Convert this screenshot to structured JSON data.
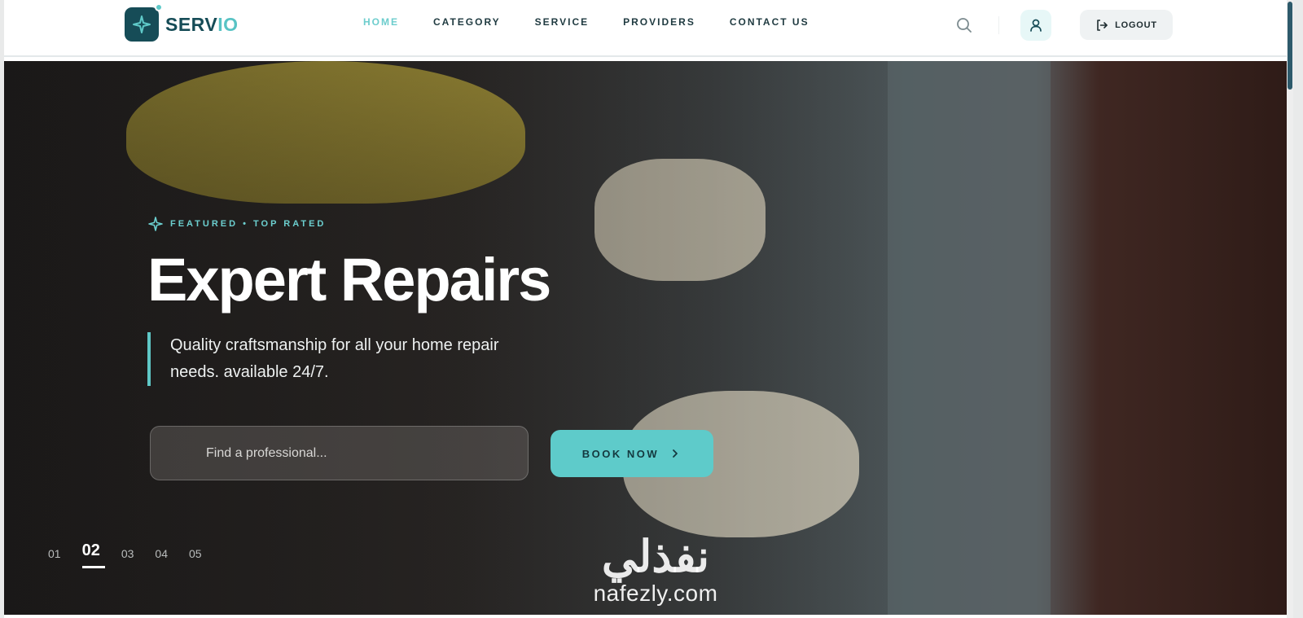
{
  "brand": {
    "name_part1": "SERV",
    "name_part2": "IO",
    "accent": "#5ecbca",
    "dark": "#164c57"
  },
  "nav": {
    "items": [
      {
        "label": "HOME",
        "active": true
      },
      {
        "label": "CATEGORY",
        "active": false
      },
      {
        "label": "SERVICE",
        "active": false
      },
      {
        "label": "PROVIDERS",
        "active": false
      },
      {
        "label": "CONTACT US",
        "active": false
      }
    ]
  },
  "header": {
    "search_icon": "search-icon",
    "user_icon": "user-icon",
    "logout_label": "LOGOUT",
    "logout_icon": "logout-icon"
  },
  "hero": {
    "eyebrow": "FEATURED • TOP RATED",
    "title": "Expert Repairs",
    "description": "Quality craftsmanship for all your home repair needs. available 24/7.",
    "search_placeholder": "Find a professional...",
    "book_label": "BOOK NOW",
    "slides": [
      {
        "label": "01",
        "active": false
      },
      {
        "label": "02",
        "active": true
      },
      {
        "label": "03",
        "active": false
      },
      {
        "label": "04",
        "active": false
      },
      {
        "label": "05",
        "active": false
      }
    ]
  },
  "watermark": {
    "arabic": "نفذلي",
    "latin": "nafezly.com"
  }
}
